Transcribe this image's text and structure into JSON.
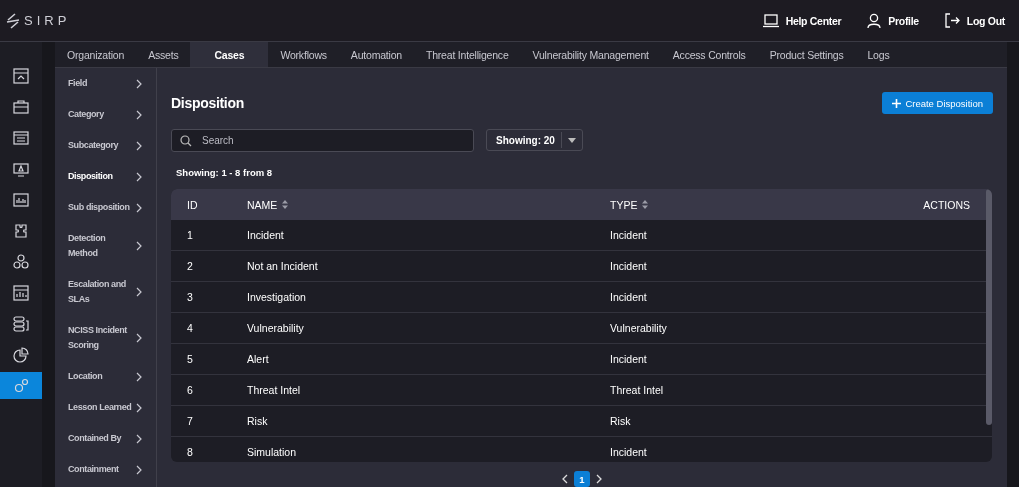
{
  "header": {
    "logo": "SIRP",
    "links": [
      {
        "label": "Help Center",
        "kind": "help"
      },
      {
        "label": "Profile",
        "kind": "profile"
      },
      {
        "label": "Log Out",
        "kind": "logout"
      }
    ]
  },
  "rail": [
    {
      "selected": false
    },
    {
      "selected": false
    },
    {
      "selected": false
    },
    {
      "selected": false
    },
    {
      "selected": false
    },
    {
      "selected": false
    },
    {
      "selected": false
    },
    {
      "selected": false
    },
    {
      "selected": false
    },
    {
      "selected": false
    },
    {
      "selected": true
    }
  ],
  "tabs": [
    {
      "label": "Organization",
      "selected": false
    },
    {
      "label": "Assets",
      "selected": false
    },
    {
      "label": "Cases",
      "selected": true
    },
    {
      "label": "Workflows",
      "selected": false
    },
    {
      "label": "Automation",
      "selected": false
    },
    {
      "label": "Threat Intelligence",
      "selected": false
    },
    {
      "label": "Vulnerability Management",
      "selected": false
    },
    {
      "label": "Access Controls",
      "selected": false
    },
    {
      "label": "Product Settings",
      "selected": false
    },
    {
      "label": "Logs",
      "selected": false
    }
  ],
  "subnav": [
    {
      "label": "Field",
      "selected": false
    },
    {
      "label": "Category",
      "selected": false
    },
    {
      "label": "Subcategory",
      "selected": false
    },
    {
      "label": "Disposition",
      "selected": true
    },
    {
      "label": "Sub disposition",
      "selected": false
    },
    {
      "label": "Detection Method",
      "selected": false
    },
    {
      "label": "Escalation and SLAs",
      "selected": false
    },
    {
      "label": "NCISS Incident Scoring",
      "selected": false
    },
    {
      "label": "Location",
      "selected": false
    },
    {
      "label": "Lesson Learned",
      "selected": false
    },
    {
      "label": "Contained By",
      "selected": false
    },
    {
      "label": "Containment",
      "selected": false
    }
  ],
  "page": {
    "title": "Disposition",
    "create_button": "Create Disposition",
    "search": {
      "placeholder": "Search"
    },
    "page_size": "Showing: 20",
    "summary": "Showing: 1 - 8 from 8"
  },
  "table": {
    "columns": [
      {
        "label": "ID",
        "sortable": false
      },
      {
        "label": "NAME",
        "sortable": true
      },
      {
        "label": "TYPE",
        "sortable": true
      },
      {
        "label": "ACTIONS",
        "sortable": false
      }
    ],
    "rows": [
      {
        "id": "1",
        "name": "Incident",
        "type": "Incident"
      },
      {
        "id": "2",
        "name": "Not an Incident",
        "type": "Incident"
      },
      {
        "id": "3",
        "name": "Investigation",
        "type": "Incident"
      },
      {
        "id": "4",
        "name": "Vulnerability",
        "type": "Vulnerability"
      },
      {
        "id": "5",
        "name": "Alert",
        "type": "Incident"
      },
      {
        "id": "6",
        "name": "Threat Intel",
        "type": "Threat Intel"
      },
      {
        "id": "7",
        "name": "Risk",
        "type": "Risk"
      },
      {
        "id": "8",
        "name": "Simulation",
        "type": "Incident"
      }
    ]
  },
  "pagination": {
    "pages": [
      {
        "label": "1",
        "selected": true
      }
    ]
  }
}
